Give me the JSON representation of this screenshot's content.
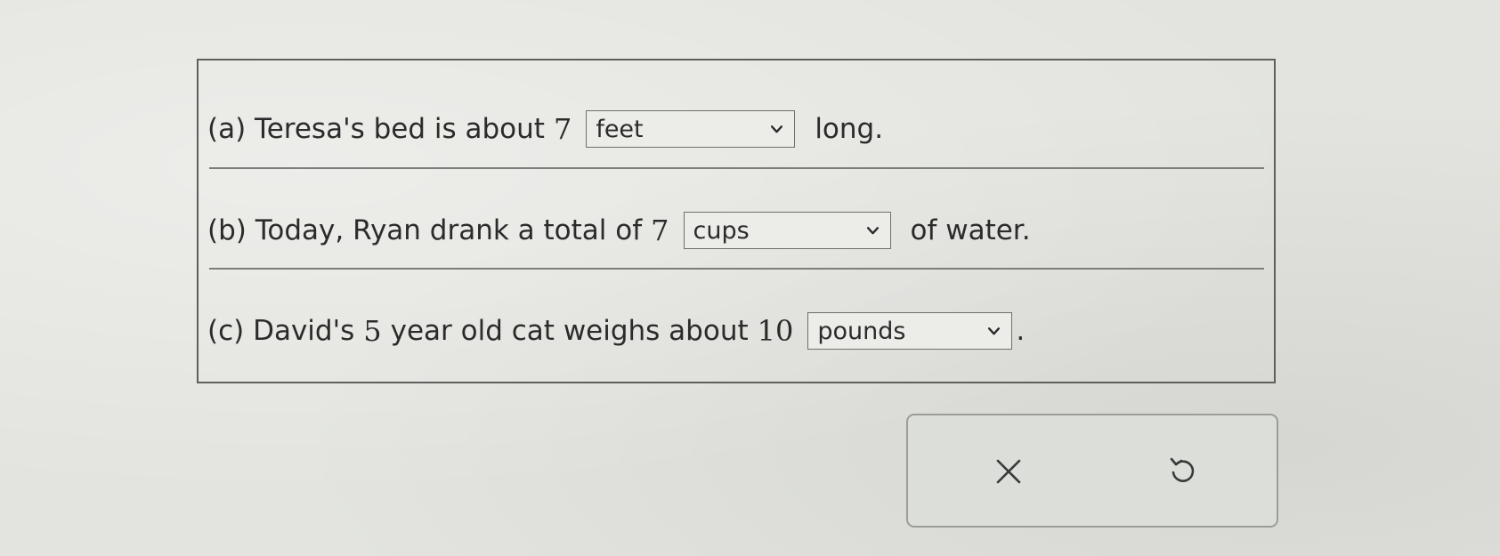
{
  "questions": [
    {
      "label": "(a)",
      "prefix": "Teresa's bed is about",
      "number": "7",
      "selected": "feet",
      "suffix": "long."
    },
    {
      "label": "(b)",
      "prefix": "Today, Ryan drank a total of",
      "number": "7",
      "selected": "cups",
      "suffix": "of water."
    },
    {
      "label": "(c)",
      "prefix": "David's",
      "number_1": "5",
      "middle": "year old cat weighs about",
      "number": "10",
      "selected": "pounds",
      "suffix": "."
    }
  ],
  "actions": {
    "clear_icon": "x-icon",
    "undo_icon": "undo-icon"
  }
}
